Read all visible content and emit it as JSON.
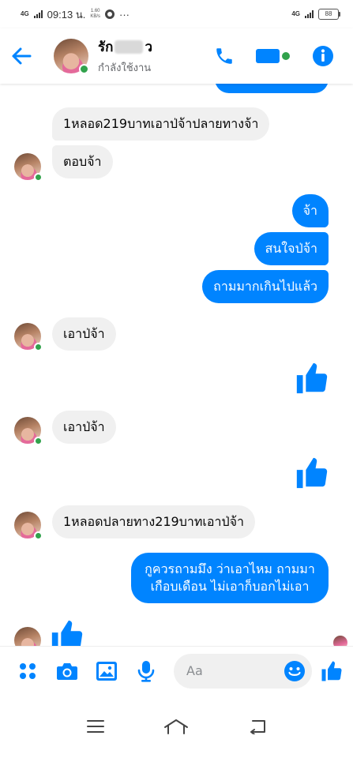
{
  "status_bar": {
    "network": "4G",
    "time": "09:13 น.",
    "speed_value": "1.60",
    "speed_unit": "KB/s",
    "more": "···",
    "network_right": "4G",
    "battery": "88"
  },
  "header": {
    "name_visible_prefix": "รัก",
    "name_visible_suffix": "ว",
    "status": "กำลังใช้งาน"
  },
  "messages": [
    {
      "side": "in",
      "text": "1หลอด219บาทเอาป่จ้าปลายทางจ้า"
    },
    {
      "side": "in",
      "text": "ตอบจ้า"
    },
    {
      "side": "out",
      "text": "จ้า"
    },
    {
      "side": "out",
      "text": "สนใจป่จ้า"
    },
    {
      "side": "out",
      "text": "ถามมากเกินไปแล้ว"
    },
    {
      "side": "in",
      "text": "เอาป่จ้า"
    },
    {
      "side": "in",
      "text": "เอาป่จ้า"
    },
    {
      "side": "in",
      "text": "1หลอดปลายทาง219บาทเอาป่จ้า"
    },
    {
      "side": "out",
      "text_line1": "กูควรถามมึง ว่าเอาไหม ถามมา",
      "text_line2": "เกือบเดือน ไม่เอาก็บอกไม่เอา"
    }
  ],
  "composer": {
    "placeholder": "Aa"
  },
  "colors": {
    "accent": "#0084ff",
    "incoming_bubble": "#f0f0f0",
    "online": "#31a24c"
  },
  "icons": {
    "header": [
      "back-arrow-icon",
      "phone-icon",
      "video-camera-icon",
      "info-icon"
    ],
    "composer": [
      "apps-grid-icon",
      "camera-icon",
      "image-icon",
      "microphone-icon",
      "emoji-icon",
      "thumbs-up-icon"
    ],
    "navbar": [
      "menu-icon",
      "home-icon",
      "back-icon"
    ]
  }
}
